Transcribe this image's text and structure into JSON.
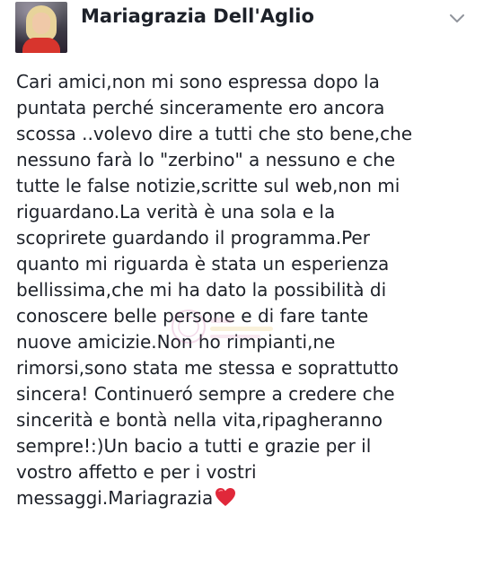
{
  "post": {
    "author_name": "Mariagrazia Dell'Aglio",
    "body_text": "Cari amici,non mi sono espressa dopo la puntata perché sinceramente ero ancora scossa ..volevo dire a tutti che sto bene,che nessuno farà lo \"zerbino\" a nessuno e che tutte le false notizie,scritte sul web,non mi riguardano.La verità è una sola e la scoprirete guardando il programma.Per quanto mi riguarda è stata un esperienza bellissima,che mi ha dato la possibilità di conoscere belle persone e di fare tante nuove amicizie.Non ho rimpianti,ne rimorsi,sono stata me stessa e soprattutto sincera! Continueró sempre a credere che sincerità e bontà nella vita,ripagheranno sempre!:)Un bacio a tutti e grazie per il vostro affetto e per i vostri messaggi.Mariagrazia",
    "body_lines": [
      "Cari amici,non mi sono espressa dopo la",
      "puntata perché sinceramente ero ancora",
      "scossa ..volevo dire a tutti che sto bene,che",
      "nessuno farà lo \"zerbino\" a nessuno e che",
      "tutte le false notizie,scritte sul web,non mi",
      "riguardano.La verità è una sola e la",
      "scoprirete guardando il programma.Per",
      "quanto mi riguarda è stata un esperienza",
      "bellissima,che mi ha dato la possibilità di",
      "conoscere belle persone e di fare tante",
      "nuove amicizie.Non ho rimpianti,ne",
      "rimorsi,sono stata me stessa e soprattutto",
      "sincera! Continueró sempre a credere che",
      "sincerità e bontà nella vita,ripagheranno",
      "sempre!:)Un bacio a tutti e grazie per il",
      "vostro affetto e per i vostri",
      "messaggi.Mariagrazia"
    ],
    "emoji": "red-heart-icon",
    "menu_icon": "chevron-down-icon"
  },
  "colors": {
    "text": "#1d2129",
    "background": "#ffffff",
    "chevron": "#90949c",
    "heart": "#e0283a"
  }
}
